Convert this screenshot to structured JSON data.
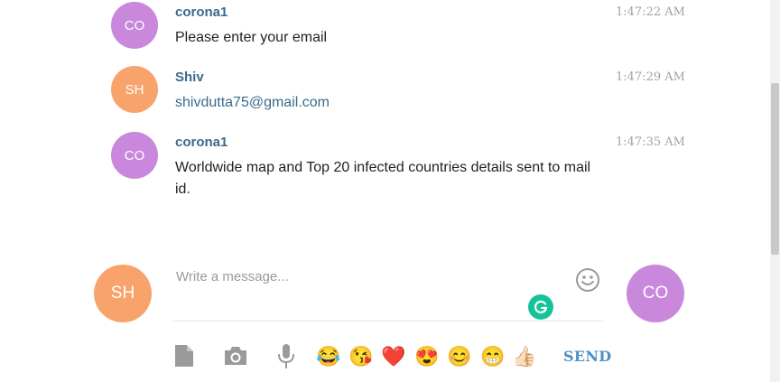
{
  "messages": [
    {
      "initials": "CO",
      "sender": "corona1",
      "time": "1:47:22 AM",
      "text": "Please enter your email",
      "avatar_color": "#c988dc"
    },
    {
      "initials": "SH",
      "sender": "Shiv",
      "time": "1:47:29 AM",
      "text": "shivdutta75@gmail.com",
      "avatar_color": "#f7a36b"
    },
    {
      "initials": "CO",
      "sender": "corona1",
      "time": "1:47:35 AM",
      "text": "Worldwide map and Top 20 infected countries details sent to mail id.",
      "avatar_color": "#c988dc"
    }
  ],
  "composer": {
    "placeholder": "Write a message...",
    "user_initials": "SH",
    "bot_initials": "CO",
    "user_color": "#f7a36b",
    "bot_color": "#c988dc"
  },
  "toolbar": {
    "icons": [
      "file-icon",
      "camera-icon",
      "microphone-icon"
    ],
    "emojis": [
      "😂",
      "😘",
      "❤️",
      "😍",
      "😊",
      "😁",
      "👍🏻"
    ],
    "send_label": "SEND"
  }
}
